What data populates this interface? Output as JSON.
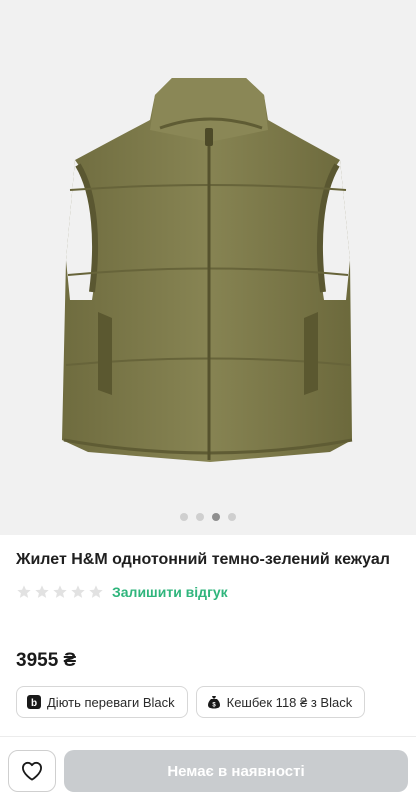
{
  "gallery": {
    "slide_count": 4,
    "active_slide": 3
  },
  "product": {
    "title": "Жилет H&M однотонний темно-зелений кежуал",
    "rating": {
      "stars": 0,
      "max": 5
    },
    "review_link": "Залишити відгук",
    "price": "3955 ₴"
  },
  "chips": [
    {
      "icon": "bonus-b-icon",
      "label": "Діють переваги Black"
    },
    {
      "icon": "money-bag-icon",
      "label": "Кешбек 118 ₴ з Black"
    }
  ],
  "actions": {
    "favorite_icon": "heart-icon",
    "buy_label": "Немає в наявності"
  },
  "colors": {
    "accent_green": "#2fb57c",
    "vest_olive": "#7d7a4a",
    "disabled_button": "#c9cccf"
  }
}
